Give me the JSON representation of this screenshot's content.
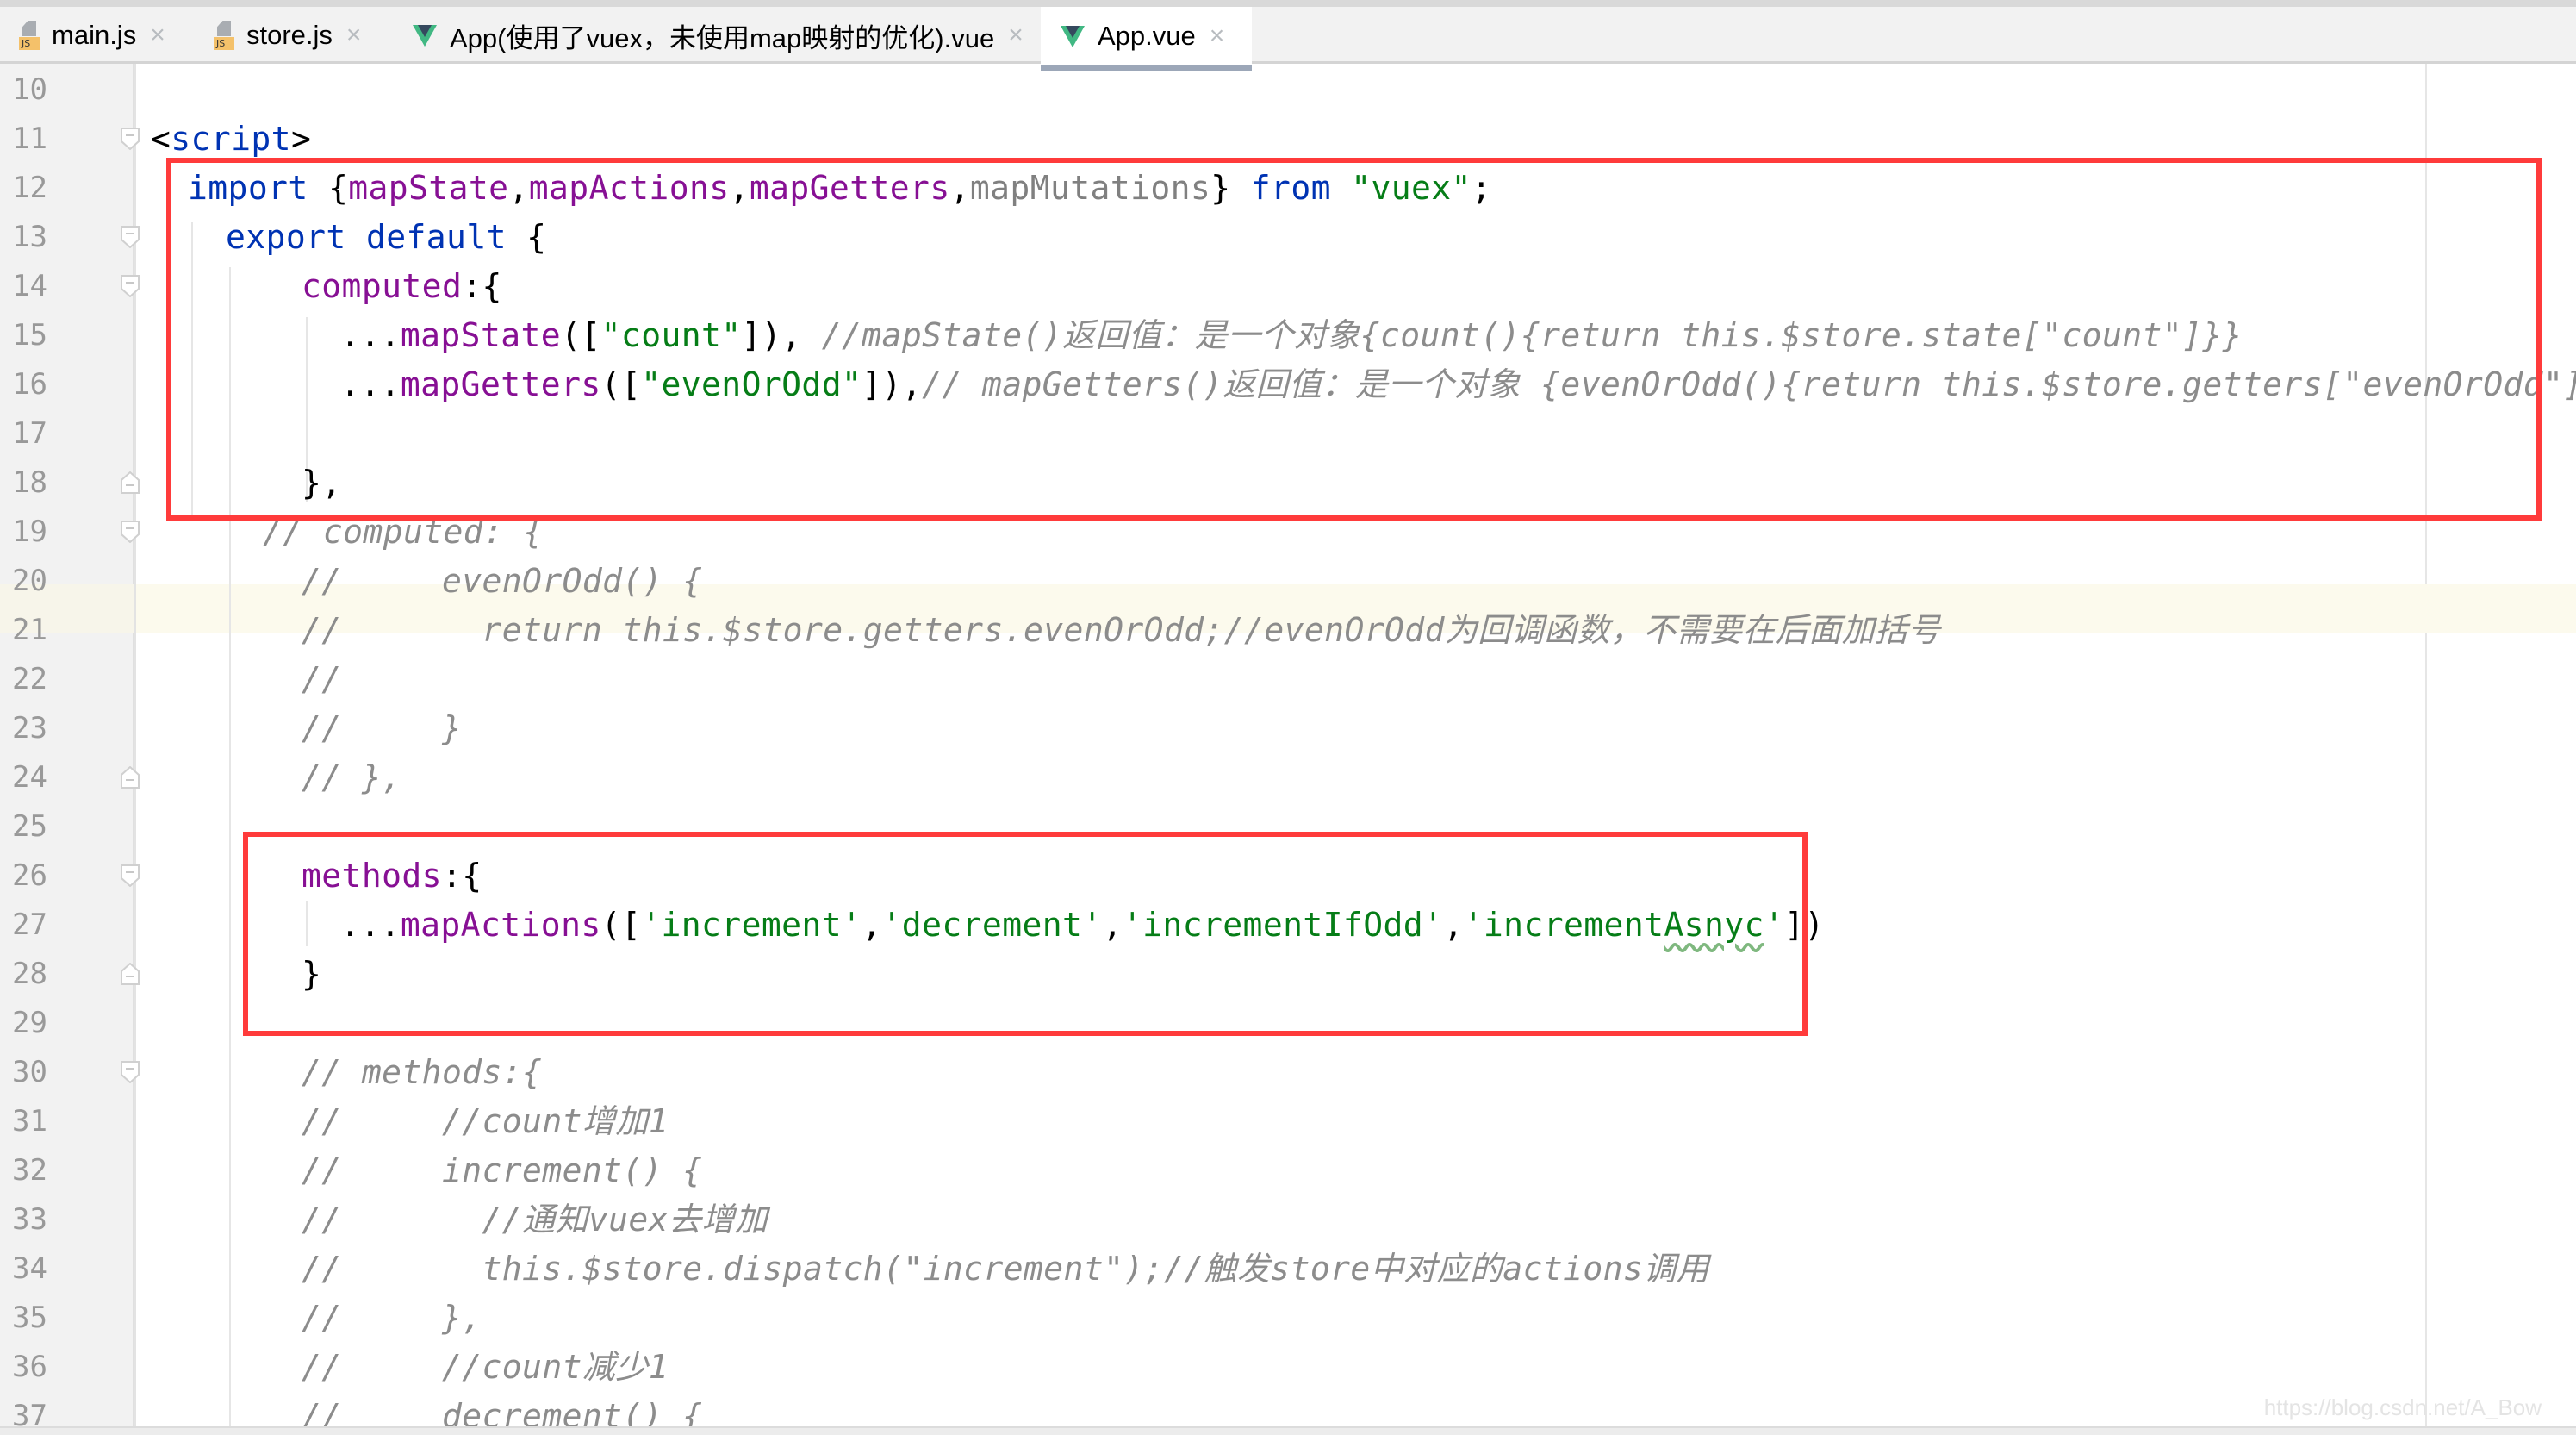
{
  "tabs": [
    {
      "label": "main.js",
      "icon": "js-file-icon",
      "active": false
    },
    {
      "label": "store.js",
      "icon": "js-file-icon",
      "active": false
    },
    {
      "label": "App(使用了vuex，未使用map映射的优化).vue",
      "icon": "vue-file-icon",
      "active": false
    },
    {
      "label": "App.vue",
      "icon": "vue-file-icon",
      "active": true
    }
  ],
  "close_glyph": "×",
  "js_badge": "JS",
  "colors": {
    "highlight_box": "#ff3b3b",
    "keyword": "#0033b3",
    "property": "#871094",
    "string": "#067d17",
    "comment": "#8c8c8c"
  },
  "lines": [
    {
      "n": "10"
    },
    {
      "n": "11"
    },
    {
      "n": "12"
    },
    {
      "n": "13"
    },
    {
      "n": "14"
    },
    {
      "n": "15"
    },
    {
      "n": "16"
    },
    {
      "n": "17"
    },
    {
      "n": "18"
    },
    {
      "n": "19"
    },
    {
      "n": "20"
    },
    {
      "n": "21"
    },
    {
      "n": "22"
    },
    {
      "n": "23"
    },
    {
      "n": "24"
    },
    {
      "n": "25"
    },
    {
      "n": "26"
    },
    {
      "n": "27"
    },
    {
      "n": "28"
    },
    {
      "n": "29"
    },
    {
      "n": "30"
    },
    {
      "n": "31"
    },
    {
      "n": "32"
    },
    {
      "n": "33"
    },
    {
      "n": "34"
    },
    {
      "n": "35"
    },
    {
      "n": "36"
    },
    {
      "n": "37"
    }
  ],
  "code": {
    "l11": {
      "open": "<",
      "tag": "script",
      "close": ">"
    },
    "l12": {
      "kw_import": "import",
      "brace_open": " {",
      "a": "mapState",
      "c1": ",",
      "b": "mapActions",
      "c2": ",",
      "c": "mapGetters",
      "c3": ",",
      "d": "mapMutations",
      "brace_close": "} ",
      "kw_from": "from",
      "sp": " ",
      "str": "\"vuex\"",
      "semi": ";"
    },
    "l13": {
      "kw": "export default",
      "rest": " {"
    },
    "l14": {
      "prop": "computed",
      "rest": ":{"
    },
    "l15": {
      "spread": "...",
      "fn": "mapState",
      "p1": "([",
      "str": "\"count\"",
      "p2": "]), ",
      "comment": "//mapState()返回值：是一个对象{count(){return this.$store.state[\"count\"]}}"
    },
    "l16": {
      "spread": "...",
      "fn": "mapGetters",
      "p1": "([",
      "str": "\"evenOrOdd\"",
      "p2": "]),",
      "comment": "// mapGetters()返回值：是一个对象 {evenOrOdd(){return this.$store.getters[\"evenOrOdd\"]}}"
    },
    "l18": "},",
    "l19": "// computed: {",
    "l20": "//     evenOrOdd() {",
    "l21": "//       return this.$store.getters.evenOrOdd;//evenOrOdd为回调函数，不需要在后面加括号",
    "l22": "//",
    "l23": "//     }",
    "l24": "// },",
    "l26": {
      "prop": "methods",
      "rest": ":{"
    },
    "l27": {
      "spread": "...",
      "fn": "mapActions",
      "p1": "([",
      "s1": "'increment'",
      "c1": ",",
      "s2": "'decrement'",
      "c2": ",",
      "s3": "'incrementIfOdd'",
      "c3": ",",
      "s4a": "'increment",
      "s4b": "Asnyc",
      "s4c": "'",
      "p2": "])"
    },
    "l28": "}",
    "l30": "// methods:{",
    "l31": "//     //count增加1",
    "l32": "//     increment() {",
    "l33": "//       //通知vuex去增加",
    "l34": "//       this.$store.dispatch(\"increment\");//触发store中对应的actions调用",
    "l35": "//     },",
    "l36": "//     //count减少1",
    "l37": "//     decrement() {"
  },
  "watermark": "https://blog.csdn.net/A_Bow"
}
